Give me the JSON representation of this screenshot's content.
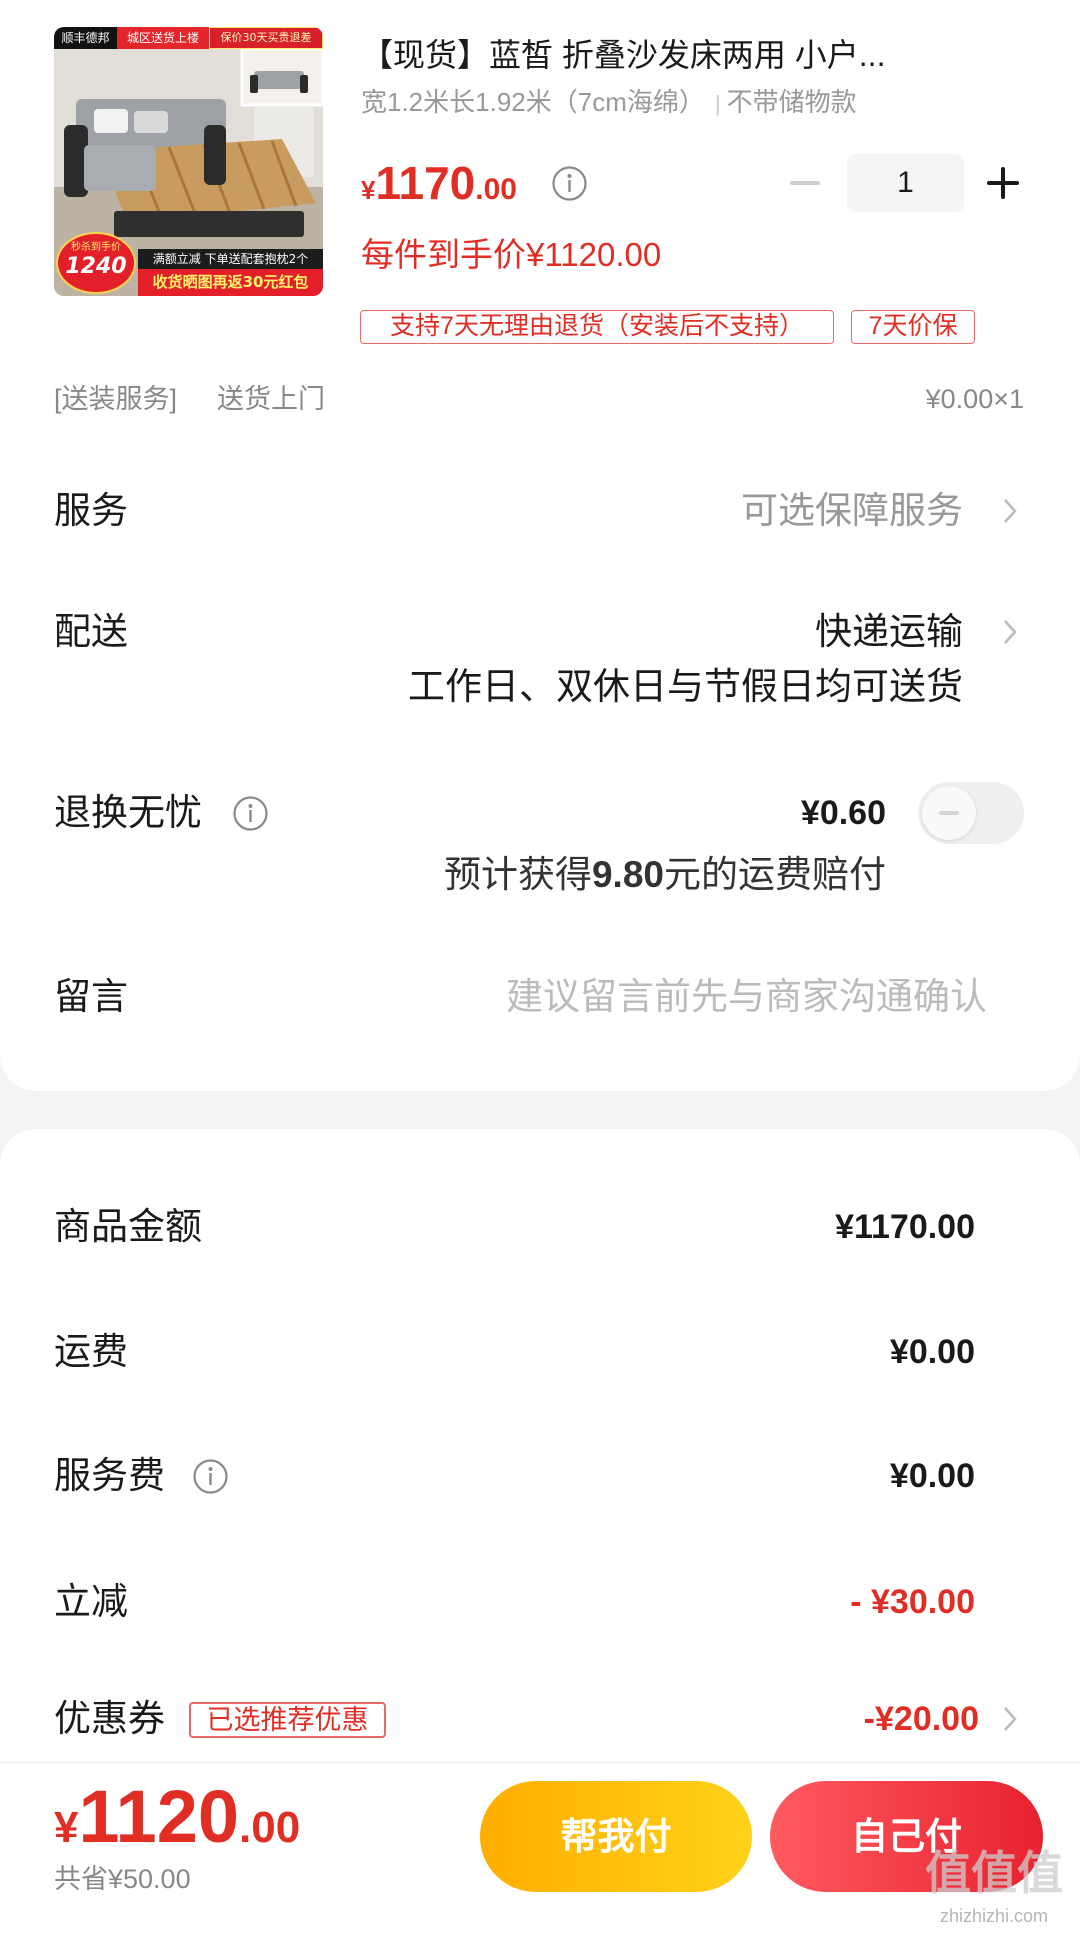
{
  "product": {
    "title": "【现货】蓝皙 折叠沙发床两用 小户...",
    "spec": "宽1.2米长1.92米（7cm海绵）",
    "spec_separator": "|",
    "variant": "不带储物款",
    "price": {
      "symbol": "¥",
      "integer": "1170",
      "decimal": ".00"
    },
    "quantity": "1",
    "final_price_label": "每件到手价¥1120.00",
    "tags": [
      "支持7天无理由退货（安装后不支持）",
      "7天价保"
    ],
    "install_service": {
      "tag": "[送装服务]",
      "name": "送货上门",
      "price": "¥0.00×1"
    },
    "image_overlays": {
      "courier": "顺丰德邦",
      "delivery": "城区送货上楼",
      "price_protect": "保价30天买贵退差",
      "badge_label": "秒杀到手价",
      "badge_price": "1240",
      "promo_line": "满额立减 下单送配套抱枕2个",
      "cashback_line": "收货晒图再返30元红包"
    }
  },
  "options": {
    "service": {
      "label": "服务",
      "value": "可选保障服务"
    },
    "delivery": {
      "label": "配送",
      "value": "快递运输",
      "note": "工作日、双休日与节假日均可送货"
    },
    "return_insurance": {
      "label": "退换无忧",
      "price": "¥0.60",
      "note_prefix": "预计获得",
      "note_amount": "9.80",
      "note_suffix": "元的运费赔付",
      "enabled": false
    },
    "message": {
      "label": "留言",
      "placeholder": "建议留言前先与商家沟通确认",
      "value": ""
    }
  },
  "summary": {
    "rows": [
      {
        "label": "商品金额",
        "value": "¥1170.00"
      },
      {
        "label": "运费",
        "value": "¥0.00"
      },
      {
        "label": "服务费",
        "value": "¥0.00"
      },
      {
        "label": "立减",
        "value": "- ¥30.00"
      },
      {
        "label": "优惠券",
        "badge": "已选推荐优惠",
        "value": "-¥20.00"
      }
    ]
  },
  "footer": {
    "total": {
      "symbol": "¥",
      "integer": "1120",
      "decimal": ".00"
    },
    "savings": "共省¥50.00",
    "pay_for_me_button": "帮我付",
    "self_pay_button": "自己付"
  },
  "watermark": {
    "logo_text": "值值值",
    "domain": "zhizhizhi.com"
  },
  "colors": {
    "accent_red": "#e02e24",
    "text_primary": "#1a1a1a",
    "text_secondary": "#999999",
    "pay_for_me_button": "#ffbe0b",
    "self_pay_button": "#ef2f3c",
    "page_background": "#f4f4f4"
  },
  "icons": [
    "info-icon",
    "chevron-right-icon",
    "minus-icon",
    "plus-icon",
    "toggle-switch"
  ]
}
